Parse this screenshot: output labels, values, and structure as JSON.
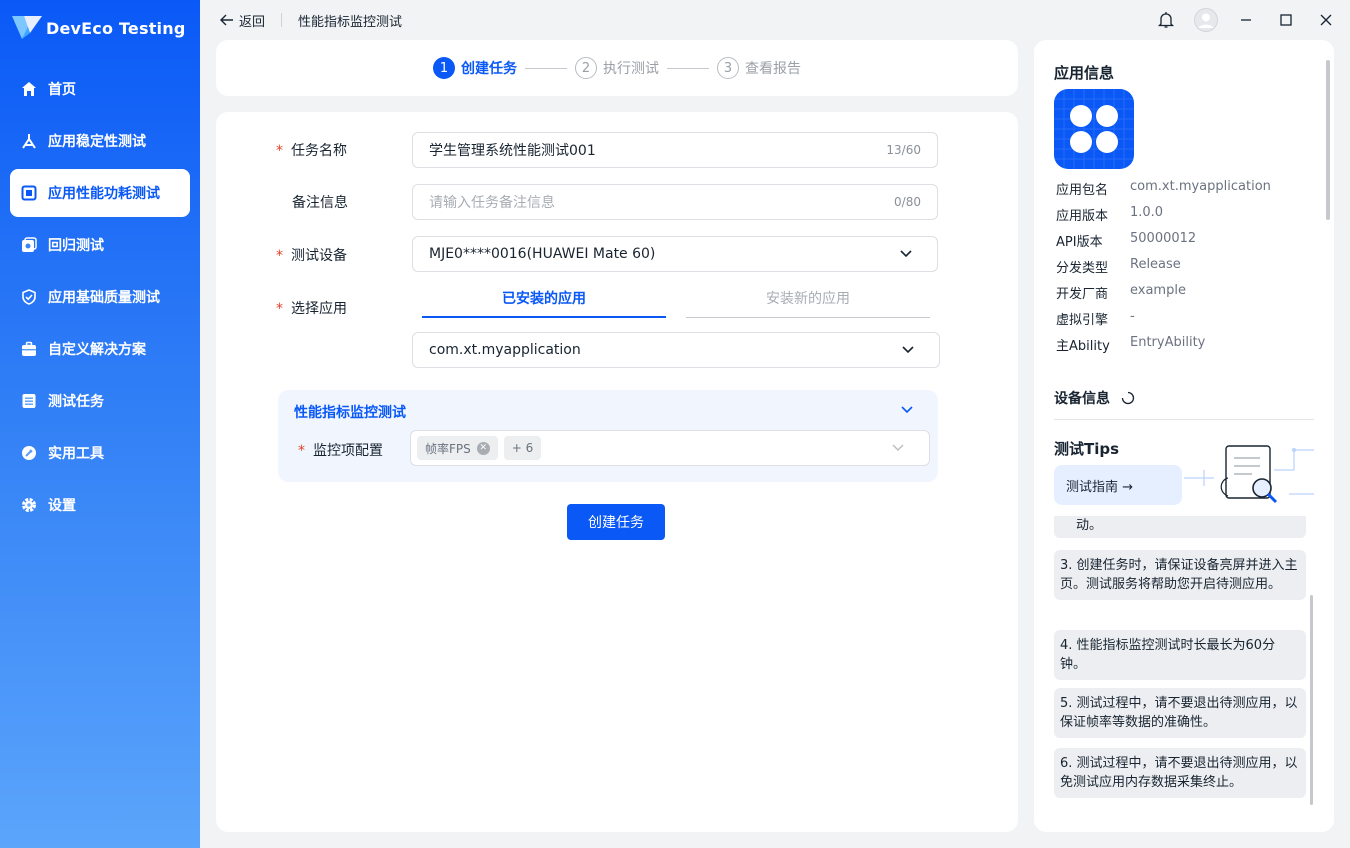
{
  "app": {
    "name": "DevEco Testing"
  },
  "sidebar": {
    "items": [
      {
        "label": "首页",
        "icon": "home-icon"
      },
      {
        "label": "应用稳定性测试",
        "icon": "stability-icon"
      },
      {
        "label": "应用性能功耗测试",
        "icon": "performance-icon",
        "active": true
      },
      {
        "label": "回归测试",
        "icon": "regression-icon"
      },
      {
        "label": "应用基础质量测试",
        "icon": "quality-check-icon"
      },
      {
        "label": "自定义解决方案",
        "icon": "briefcase-icon"
      },
      {
        "label": "测试任务",
        "icon": "task-list-icon"
      },
      {
        "label": "实用工具",
        "icon": "tools-icon"
      },
      {
        "label": "设置",
        "icon": "gear-icon"
      }
    ]
  },
  "titlebar": {
    "back_label": "返回",
    "page_title": "性能指标监控测试"
  },
  "stepper": {
    "steps": [
      {
        "num": "1",
        "label": "创建任务",
        "state": "active"
      },
      {
        "num": "2",
        "label": "执行测试",
        "state": "todo"
      },
      {
        "num": "3",
        "label": "查看报告",
        "state": "todo"
      }
    ]
  },
  "form": {
    "required_mark": "*",
    "task_name": {
      "label": "任务名称",
      "value": "学生管理系统性能测试001",
      "count": "13/60"
    },
    "remark": {
      "label": "备注信息",
      "placeholder": "请输入任务备注信息",
      "count": "0/80"
    },
    "device": {
      "label": "测试设备",
      "value": "MJE0****0016(HUAWEI Mate 60)"
    },
    "app_select": {
      "label": "选择应用",
      "tab_installed": "已安装的应用",
      "tab_new": "安装新的应用",
      "value": "com.xt.myapplication"
    },
    "monitor": {
      "title": "性能指标监控测试",
      "config_label": "监控项配置",
      "tag": "帧率FPS",
      "more": "+ 6"
    },
    "submit_label": "创建任务"
  },
  "app_info": {
    "title": "应用信息",
    "rows": [
      {
        "k": "应用包名",
        "v": "com.xt.myapplication"
      },
      {
        "k": "应用版本",
        "v": "1.0.0"
      },
      {
        "k": "API版本",
        "v": "50000012"
      },
      {
        "k": "分发类型",
        "v": "Release"
      },
      {
        "k": "开发厂商",
        "v": "example"
      },
      {
        "k": "虚拟引擎",
        "v": "-"
      },
      {
        "k": "主Ability",
        "v": "EntryAbility"
      }
    ]
  },
  "device_info": {
    "title": "设备信息"
  },
  "tips": {
    "title": "测试Tips",
    "guide_label": "测试指南 →",
    "items": [
      "动。",
      "3. 创建任务时，请保证设备亮屏并进入主页。测试服务将帮助您开启待测应用。",
      "4. 性能指标监控测试时长最长为60分钟。",
      "5. 测试过程中，请不要退出待测应用，以保证帧率等数据的准确性。",
      "6. 测试过程中，请不要退出待测应用，以免测试应用内存数据采集终止。"
    ]
  }
}
